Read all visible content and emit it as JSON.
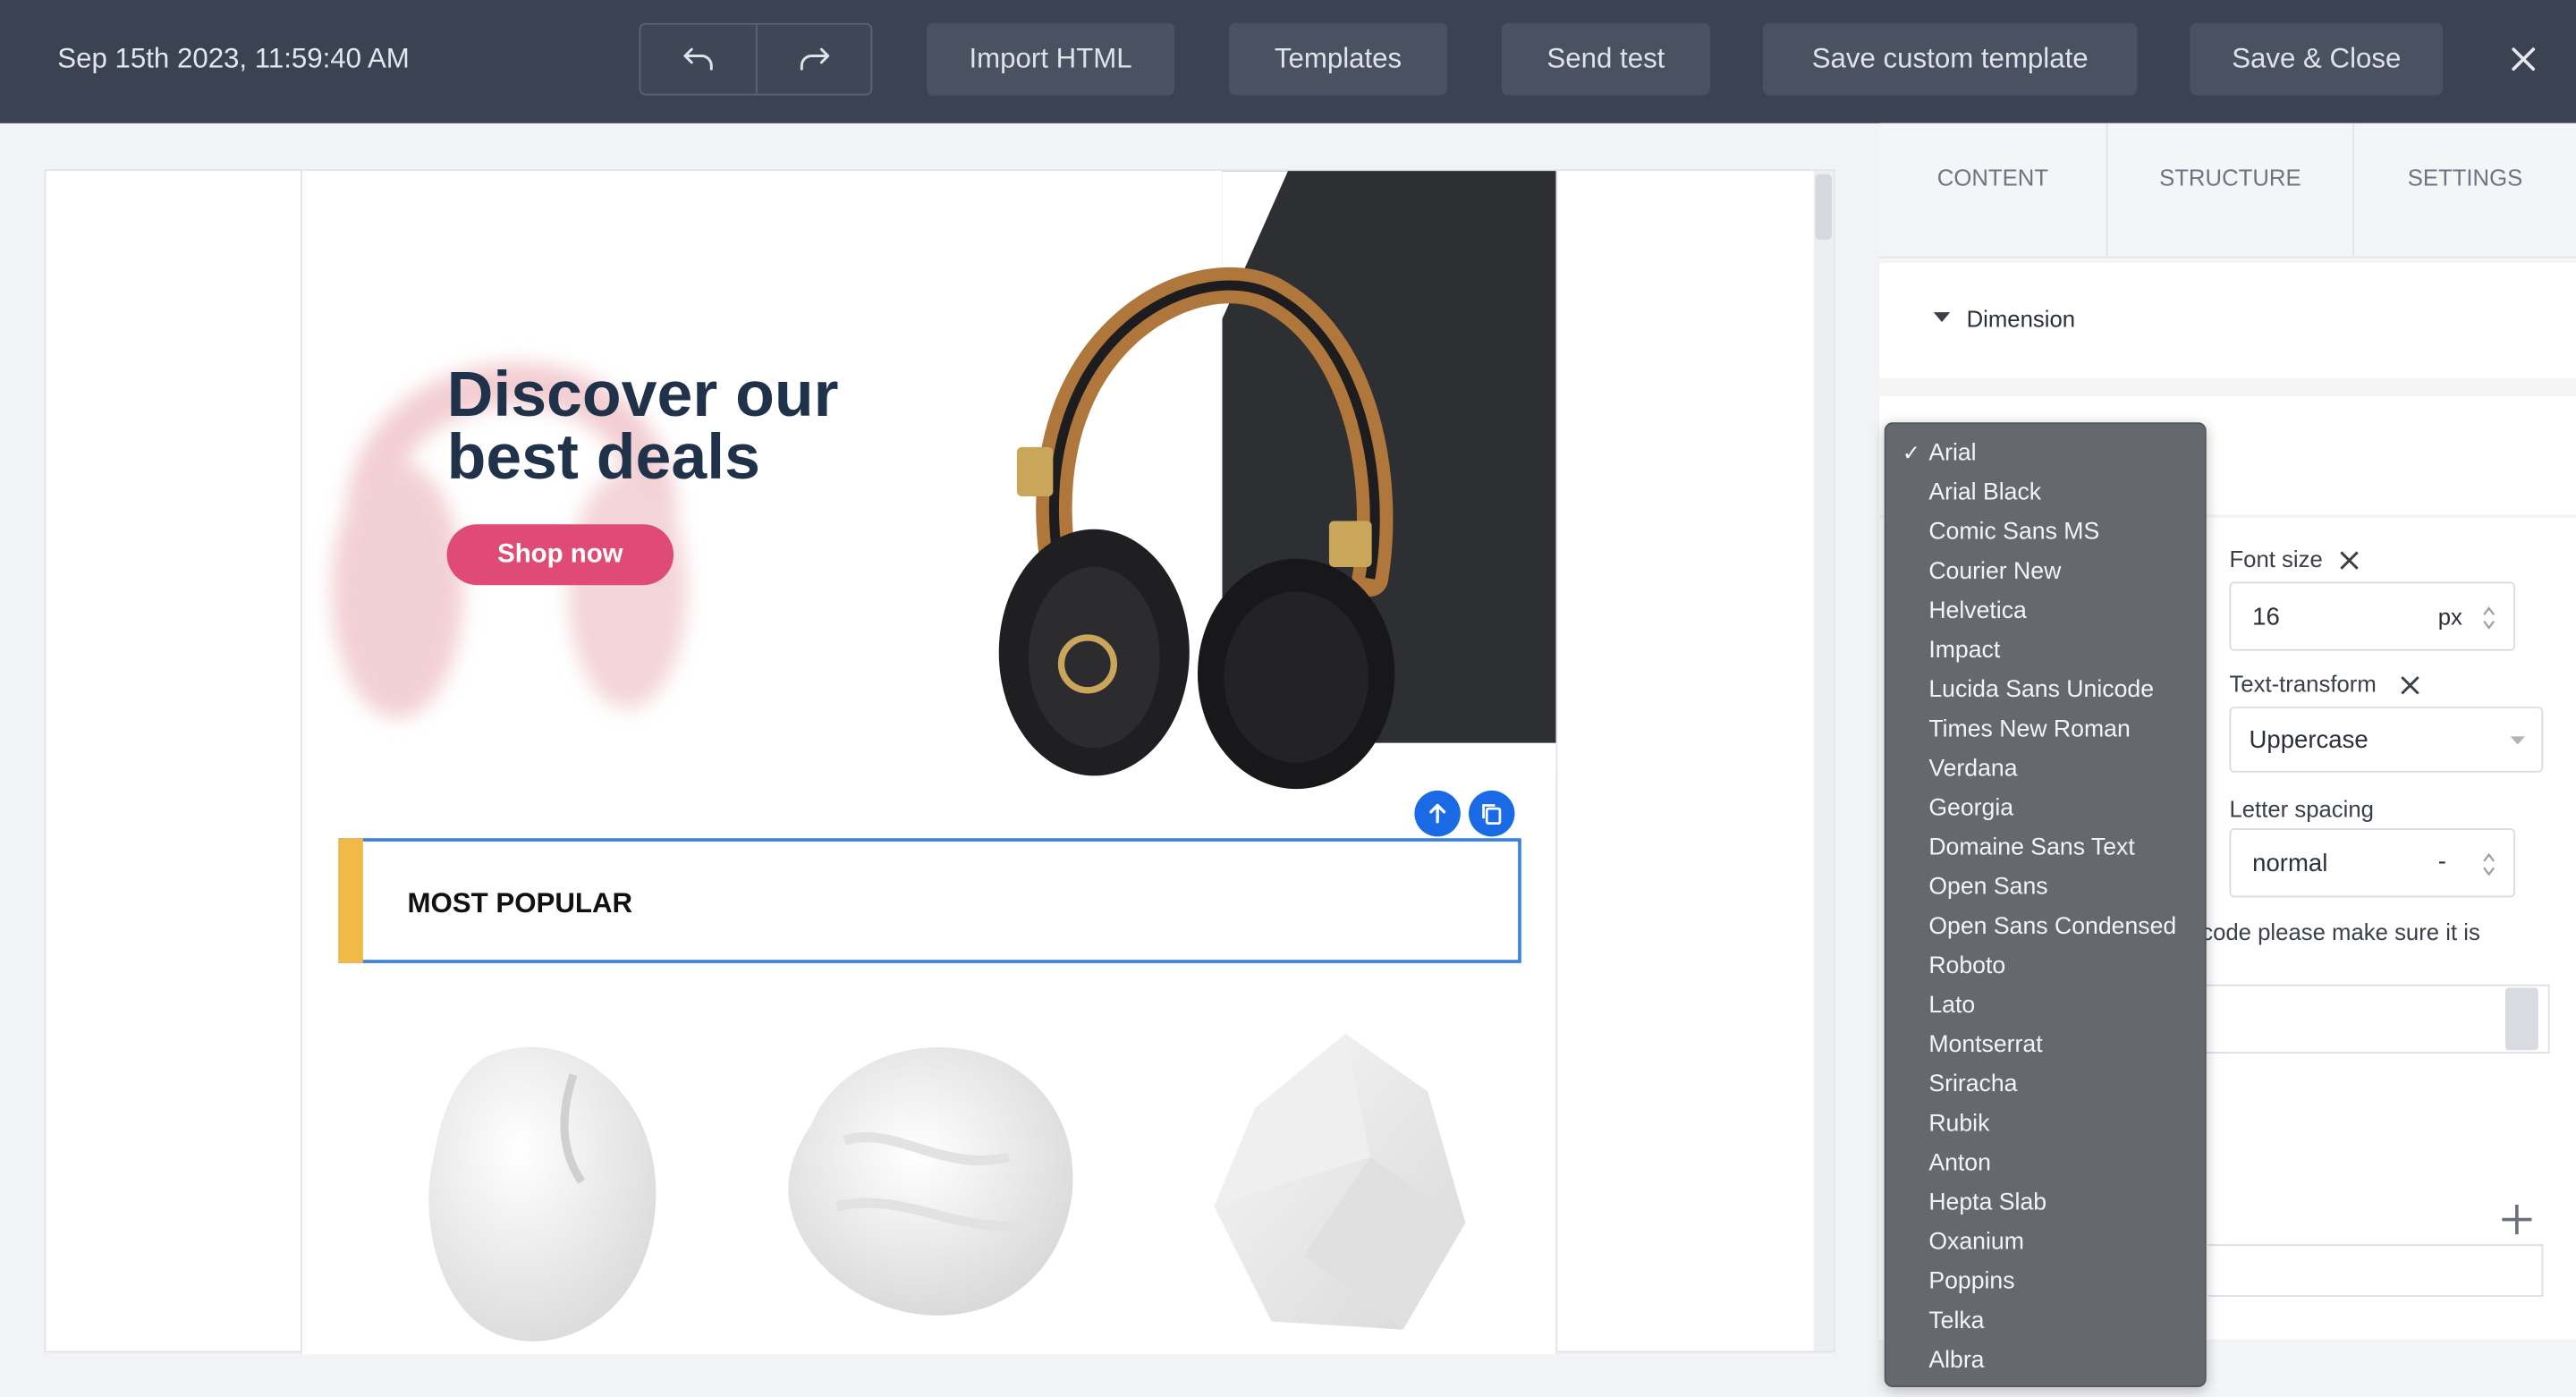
{
  "topbar": {
    "timestamp": "Sep 15th 2023, 11:59:40 AM",
    "buttons": [
      "Import HTML",
      "Templates",
      "Send test",
      "Save custom template",
      "Save & Close"
    ]
  },
  "email": {
    "headline_line1": "Discover our",
    "headline_line2": "best deals",
    "cta": "Shop now",
    "section_title": "MOST POPULAR"
  },
  "panel": {
    "tabs": [
      "CONTENT",
      "STRUCTURE",
      "SETTINGS"
    ],
    "dimension": "Dimension",
    "font_size_label": "Font size",
    "font_size_value": "16",
    "font_size_unit": "px",
    "text_transform_label": "Text-transform",
    "text_transform_value": "Uppercase",
    "letter_spacing_label": "Letter spacing",
    "letter_spacing_value": "normal",
    "letter_spacing_unit": "-",
    "note": "code please make sure it is"
  },
  "font_dropdown": {
    "selected": "Arial",
    "options": [
      "Arial",
      "Arial Black",
      "Comic Sans MS",
      "Courier New",
      "Helvetica",
      "Impact",
      "Lucida Sans Unicode",
      "Times New Roman",
      "Verdana",
      "Georgia",
      "Domaine Sans Text",
      "Open Sans",
      "Open Sans Condensed",
      "Roboto",
      "Lato",
      "Montserrat",
      "Sriracha",
      "Rubik",
      "Anton",
      "Hepta Slab",
      "Oxanium",
      "Poppins",
      "Telka",
      "Albra"
    ]
  },
  "colors": {
    "topbar": "#3b4252",
    "cta": "#e04b76",
    "accent_bar": "#f1b948",
    "selection": "#3b82e0",
    "headline": "#20324a"
  }
}
